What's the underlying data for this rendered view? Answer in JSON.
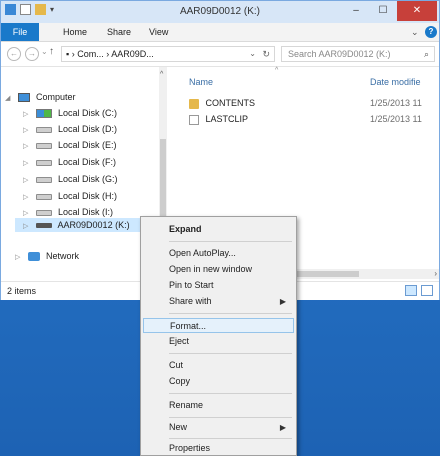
{
  "window": {
    "title": "AAR09D0012 (K:)",
    "controls": {
      "minimize": "–",
      "maximize": "☐",
      "close": "✕"
    }
  },
  "ribbon": {
    "tabs": [
      "File",
      "Home",
      "Share",
      "View"
    ],
    "expand_icon": "⌄",
    "help_icon": "?"
  },
  "address": {
    "path": "▪ › Com... › AAR09D...",
    "search_placeholder": "Search AAR09D0012 (K:)"
  },
  "nav": {
    "items": [
      {
        "label": "Computer"
      },
      {
        "label": "Local Disk (C:)"
      },
      {
        "label": "Local Disk (D:)"
      },
      {
        "label": "Local Disk (E:)"
      },
      {
        "label": "Local Disk (F:)"
      },
      {
        "label": "Local Disk (G:)"
      },
      {
        "label": "Local Disk (H:)"
      },
      {
        "label": "Local Disk (I:)"
      },
      {
        "label": "AAR09D0012 (K:)"
      },
      {
        "label": "Network"
      }
    ]
  },
  "content": {
    "columns": {
      "name": "Name",
      "date": "Date modifie"
    },
    "files": [
      {
        "name": "CONTENTS",
        "date": "1/25/2013 11",
        "type": "folder"
      },
      {
        "name": "LASTCLIP",
        "date": "1/25/2013 11",
        "type": "file"
      }
    ]
  },
  "status": {
    "items": "2 items"
  },
  "menu": {
    "items": [
      {
        "label": "Expand"
      },
      {
        "label": "Open AutoPlay..."
      },
      {
        "label": "Open in new window"
      },
      {
        "label": "Pin to Start"
      },
      {
        "label": "Share with"
      },
      {
        "label": "Format..."
      },
      {
        "label": "Eject"
      },
      {
        "label": "Cut"
      },
      {
        "label": "Copy"
      },
      {
        "label": "Rename"
      },
      {
        "label": "New"
      },
      {
        "label": "Properties"
      }
    ]
  }
}
